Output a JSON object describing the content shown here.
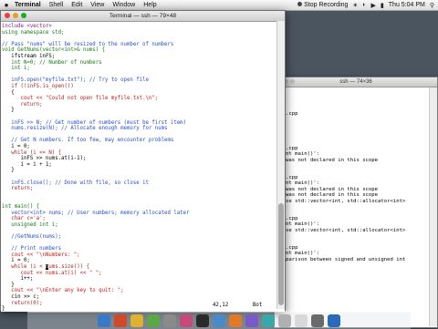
{
  "menubar": {
    "apple": "",
    "items": [
      "Terminal",
      "Shell",
      "Edit",
      "View",
      "Window",
      "Help"
    ],
    "recording": "Stop Recording",
    "clock": "Thu 5:04 PM"
  },
  "main_window": {
    "title": "Terminal — ssh — 79×48",
    "code_lines": [
      {
        "text": "include <vector>",
        "color": "#8a1a8a"
      },
      {
        "text": "using namespace std;",
        "color": "#1a7a1a"
      },
      {
        "text": "",
        "color": "#000000"
      },
      {
        "text": "// Pass \"nums\" will be resized to the number of numbers",
        "color": "#2a4fc8"
      },
      {
        "text": "void GetNums(vector<int>& nums) {",
        "color": "#1a7a1a"
      },
      {
        "text": "   ifstream inFS;",
        "color": "#000000"
      },
      {
        "text": "   int N=0; // Number of numbers",
        "color": "#1a7a1a"
      },
      {
        "text": "   int i;",
        "color": "#1a7a1a"
      },
      {
        "text": "",
        "color": "#000000"
      },
      {
        "text": "   inFS.open(\"myfile.txt\"); // Try to open file",
        "color": "#2a4fc8"
      },
      {
        "text": "   if (!inFS.is_open())",
        "color": "#a52a2a"
      },
      {
        "text": "   {",
        "color": "#000000"
      },
      {
        "text": "      cout << \"Could not open file myfile.txt.\\n\";",
        "color": "#c81a1a"
      },
      {
        "text": "      return;",
        "color": "#a52a2a"
      },
      {
        "text": "   }",
        "color": "#000000"
      },
      {
        "text": "",
        "color": "#000000"
      },
      {
        "text": "   inFS >> N; // Get number of numbers (must be first item)",
        "color": "#2a4fc8"
      },
      {
        "text": "   nums.resize(N); // Allocate enough memory for nums",
        "color": "#2a4fc8"
      },
      {
        "text": "",
        "color": "#000000"
      },
      {
        "text": "   // Get N numbers. If too few, may encounter problems",
        "color": "#2a4fc8"
      },
      {
        "text": "   i = 0;",
        "color": "#000000"
      },
      {
        "text": "   while (i <= N) {",
        "color": "#a52a2a"
      },
      {
        "text": "      inFS >> nums.at(i-1);",
        "color": "#000000"
      },
      {
        "text": "      i = i + 1;",
        "color": "#000000"
      },
      {
        "text": "   }",
        "color": "#000000"
      },
      {
        "text": "",
        "color": "#000000"
      },
      {
        "text": "   inFS.close(); // Done with file, so close it",
        "color": "#2a4fc8"
      },
      {
        "text": "   return;",
        "color": "#a52a2a"
      },
      {
        "text": "",
        "color": "#000000"
      },
      {
        "text": "",
        "color": "#000000"
      },
      {
        "text": "int main() {",
        "color": "#1a7a1a"
      },
      {
        "text": "   vector<int> nums; // User numbers; memory allocated later",
        "color": "#2a4fc8"
      },
      {
        "text": "   char c='a';",
        "color": "#c81a1a"
      },
      {
        "text": "   unsigned int i;",
        "color": "#1a7a1a"
      },
      {
        "text": "",
        "color": "#000000"
      },
      {
        "text": "   //GetNums(nums);",
        "color": "#2a4fc8"
      },
      {
        "text": "",
        "color": "#000000"
      },
      {
        "text": "   // Print numbers",
        "color": "#2a4fc8"
      },
      {
        "text": "   cout << \"\\nNumbers: \";",
        "color": "#c81a1a"
      },
      {
        "text": "   i = 0;",
        "color": "#000000"
      },
      {
        "text": "   while (i < nums.size()) {",
        "color": "#a52a2a"
      },
      {
        "text": "      cout << nums.at(i) << \" \";",
        "color": "#c81a1a"
      },
      {
        "text": "      i++;",
        "color": "#000000"
      },
      {
        "text": "   }",
        "color": "#000000"
      },
      {
        "text": "   cout << \"\\nEnter any key to quit: \";",
        "color": "#c81a1a"
      },
      {
        "text": "   cin >> c;",
        "color": "#000000"
      },
      {
        "text": "   return(0);",
        "color": "#a52a2a"
      },
      {
        "text": "}",
        "color": "#000000"
      }
    ],
    "cursor_line_index": 40,
    "status_position": "42,12",
    "status_percent": "Bot"
  },
  "back_window": {
    "title": "ssh — 74×36",
    "lines": [
      {
        "text": ".cpp",
        "row": 4
      },
      {
        "text": "",
        "row": 5
      },
      {
        "text": "",
        "row": 6
      },
      {
        "text": ".cpp",
        "row": 10
      },
      {
        "text": "nt main()':",
        "row": 11
      },
      {
        "text": "was not declared in this scope",
        "row": 12
      },
      {
        "text": ".cpp",
        "row": 15
      },
      {
        "text": "nt main()':",
        "row": 16
      },
      {
        "text": "was not declared in this scope",
        "row": 17
      },
      {
        "text": "was not declared in this scope",
        "row": 18
      },
      {
        "text": "se std::vector<int, std::allocator<int>",
        "row": 19
      },
      {
        "text": ".cpp",
        "row": 22
      },
      {
        "text": "nt main()':",
        "row": 23
      },
      {
        "text": "se std::vector<int, std::allocator<int>",
        "row": 24
      },
      {
        "text": ".cpp",
        "row": 27
      },
      {
        "text": "nt main()':",
        "row": 28
      },
      {
        "text": "parison between signed and unsigned int",
        "row": 29
      }
    ]
  },
  "dock": {
    "icon_colors": [
      "#3a78c8",
      "#d04a2a",
      "#e0b030",
      "#5aa84a",
      "#8a8a8a",
      "#c84a7a",
      "#2a2a2a",
      "#4a8ac8",
      "#e07a2a",
      "#7a5ac8",
      "#3aa8a8",
      "#b0b0b0",
      "#d8d8d8",
      "#6a6a6a",
      "#2a6ab8"
    ]
  }
}
